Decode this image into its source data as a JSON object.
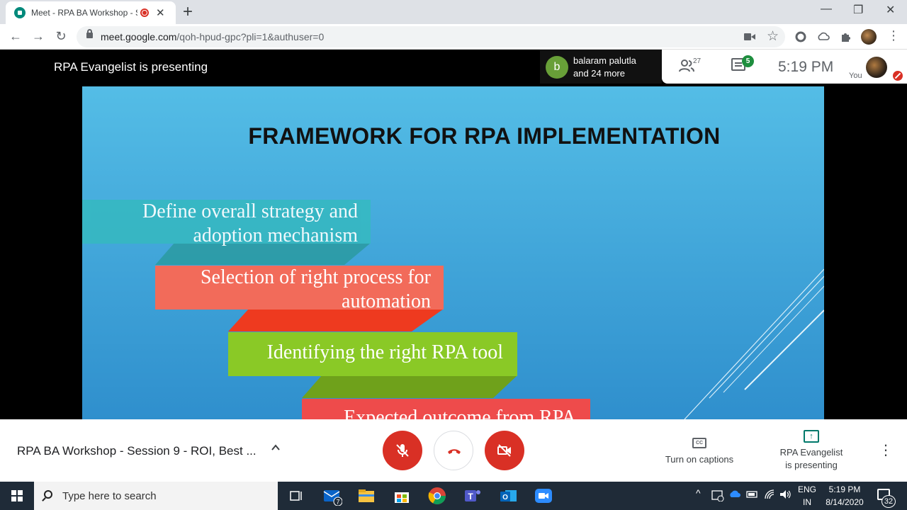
{
  "browser": {
    "tab": {
      "title": "Meet - RPA BA Workshop - S",
      "close": "✕"
    },
    "new_tab": "+",
    "window_controls": {
      "minimize": "—",
      "restore": "❐",
      "close": "✕"
    },
    "nav": {
      "back": "←",
      "forward": "→",
      "reload": "↻"
    },
    "url_host": "meet.google.com",
    "url_path": "/qoh-hpud-gpc?pli=1&authuser=0",
    "icons": [
      "video-camera-icon",
      "star-icon",
      "extension-circle-icon",
      "extension-cloud-icon",
      "puzzle-icon",
      "profile-avatar",
      "kebab-menu-icon"
    ]
  },
  "meet": {
    "presenting_banner": "RPA Evangelist is presenting",
    "joined": {
      "avatar_letter": "b",
      "name": "balaram palutla",
      "more": "and 24 more"
    },
    "participants_count": "27",
    "chat_badge": "5",
    "clock": "5:19  PM",
    "you_label": "You",
    "meeting_title": "RPA BA Workshop - Session 9 - ROI, Best ...",
    "captions_label": "Turn on captions",
    "cc_icon": "CC",
    "presenting_label_1": "RPA Evangelist",
    "presenting_label_2": "is presenting",
    "more": "⋮",
    "mic_muted": true,
    "camera_off": true
  },
  "slide": {
    "title": "FRAMEWORK FOR RPA IMPLEMENTATION",
    "steps": [
      {
        "line1": "Define overall strategy and",
        "line2": "adoption mechanism",
        "color": "#36b8c2",
        "connector": "#2a9aa0"
      },
      {
        "line1": "Selection of right process for",
        "line2": "automation",
        "color": "#f26b5a",
        "connector": "#ee3a1f"
      },
      {
        "line1": "Identifying the right RPA tool",
        "line2": "",
        "color": "#8ac926",
        "connector": "#6fa11b"
      },
      {
        "line1": "Expected outcome from RPA",
        "line2": "",
        "color": "#ee4b4b",
        "connector": ""
      }
    ]
  },
  "taskbar": {
    "search_placeholder": "Type here to search",
    "mail_badge": "7",
    "lang_1": "ENG",
    "lang_2": "IN",
    "time": "5:19 PM",
    "date": "8/14/2020",
    "notifications": "32"
  },
  "colors": {
    "meet_red": "#d93025",
    "chat_green": "#1e8e3e",
    "present_teal": "#00796b",
    "slide_top": "#54bde6",
    "slide_bottom": "#2f8fcd"
  }
}
